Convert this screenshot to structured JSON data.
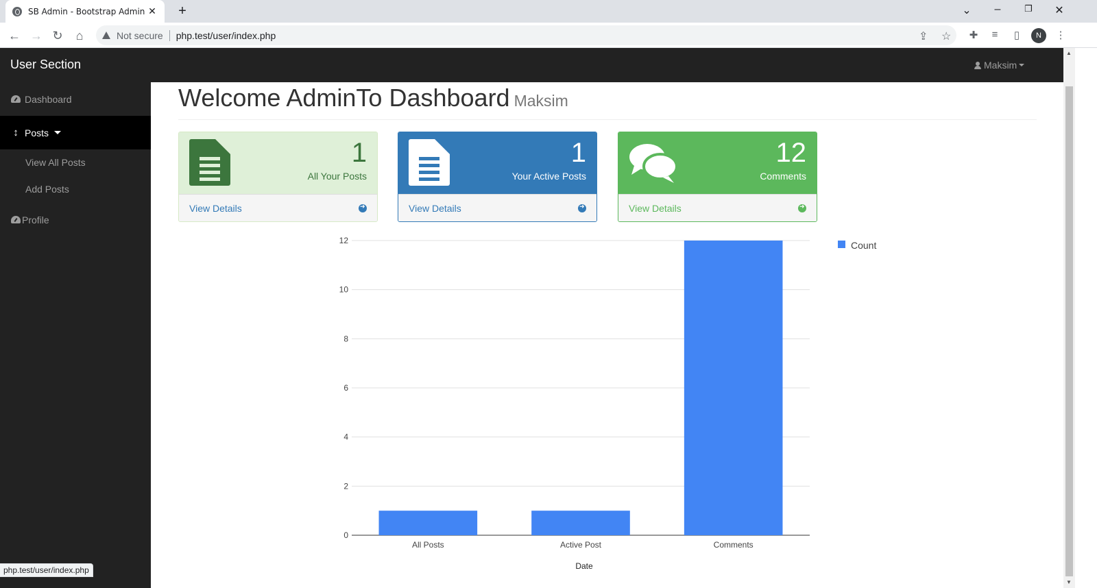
{
  "browser": {
    "tab_title": "SB Admin - Bootstrap Admin Ten",
    "security_label": "Not secure",
    "url": "php.test/user/index.php",
    "profile_initial": "N",
    "status_url": "php.test/user/index.php"
  },
  "navbar": {
    "brand": "User Section",
    "user_name": "Maksim"
  },
  "sidebar": {
    "items": [
      {
        "label": "Dashboard"
      },
      {
        "label": "Posts"
      },
      {
        "label": "View All Posts"
      },
      {
        "label": "Add Posts"
      },
      {
        "label": "Profile"
      }
    ]
  },
  "header": {
    "title": "Welcome AdminTo Dashboard",
    "subtitle": "Maksim"
  },
  "panels": [
    {
      "count": "1",
      "label": "All Your Posts",
      "link": "View Details",
      "color": "#dff0d8"
    },
    {
      "count": "1",
      "label": "Your Active Posts",
      "link": "View Details",
      "color": "#337ab7"
    },
    {
      "count": "12",
      "label": "Comments",
      "link": "View Details",
      "color": "#5cb85c"
    }
  ],
  "chart_data": {
    "type": "bar",
    "categories": [
      "All Posts",
      "Active Post",
      "Comments"
    ],
    "series": [
      {
        "name": "Count",
        "values": [
          1,
          1,
          12
        ],
        "color": "#4285f4"
      }
    ],
    "xlabel": "Date",
    "ylabel": "",
    "ylim": [
      0,
      12
    ],
    "yticks": [
      0,
      2,
      4,
      6,
      8,
      10,
      12
    ],
    "grid": true,
    "legend": "top-right"
  }
}
